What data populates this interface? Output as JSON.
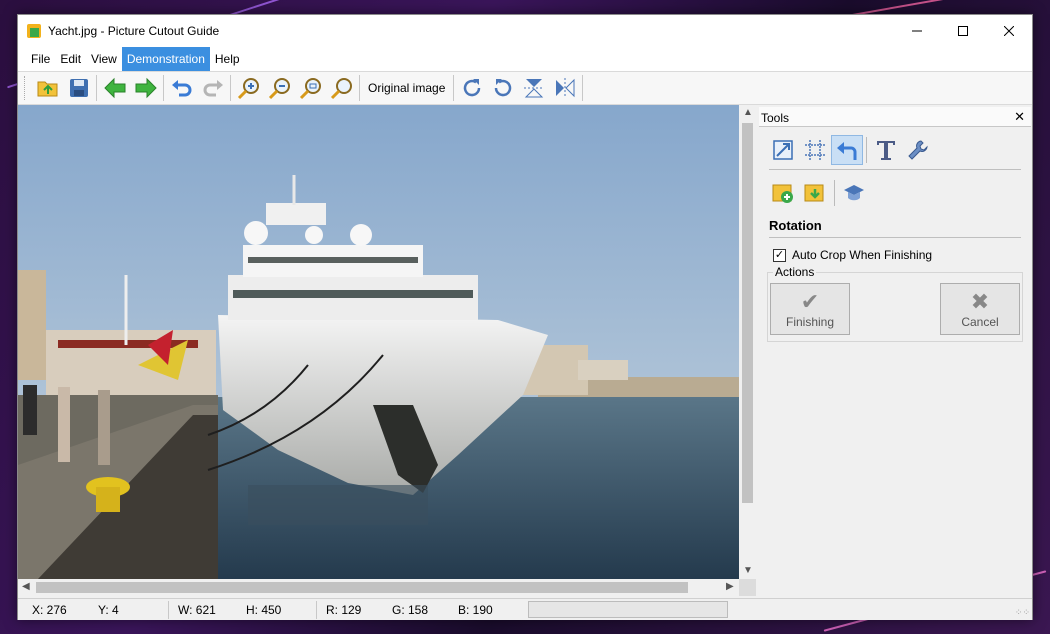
{
  "window": {
    "title": "Yacht.jpg - Picture Cutout Guide"
  },
  "menu": [
    "File",
    "Edit",
    "View",
    "Demonstration",
    "Help"
  ],
  "toolbar": {
    "original_image_label": "Original image"
  },
  "tools_panel": {
    "title": "Tools",
    "section_title": "Rotation",
    "auto_crop_label": "Auto Crop When Finishing",
    "auto_crop_checked": true,
    "actions_label": "Actions",
    "finishing_label": "Finishing",
    "cancel_label": "Cancel"
  },
  "status": {
    "x": "X: 276",
    "y": "Y: 4",
    "w": "W: 621",
    "h": "H: 450",
    "r": "R: 129",
    "g": "G: 158",
    "b": "B: 190"
  },
  "colors": {
    "menu_highlight": "#3b8fe0",
    "sky": "#86a7cc",
    "water": "#304a63"
  }
}
